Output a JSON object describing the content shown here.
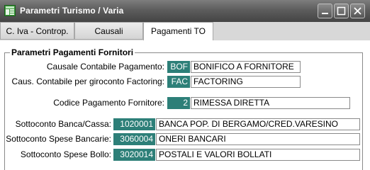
{
  "window": {
    "title": "Parametri Turismo / Varia",
    "minimize_label": "_",
    "maximize_label": "□",
    "close_label": "✕"
  },
  "tabs": [
    {
      "label": "C. Iva - Controp.",
      "active": false
    },
    {
      "label": "Causali",
      "active": false
    },
    {
      "label": "Pagamenti TO",
      "active": true
    }
  ],
  "group": {
    "title": "Parametri Pagamenti Fornitori"
  },
  "fields": {
    "causale_pagamento": {
      "label": "Causale Contabile Pagamento:",
      "code": "BOF",
      "value": "BONIFICO A FORNITORE"
    },
    "causale_giroconto": {
      "label": "Caus. Contabile per giroconto Factoring:",
      "code": "FAC",
      "value": "FACTORING"
    },
    "codice_pagamento": {
      "label": "Codice Pagamento Fornitore:",
      "code": "2",
      "value": "RIMESSA DIRETTA"
    },
    "sottoconto_banca": {
      "label": "Sottoconto Banca/Cassa:",
      "code": "1020001",
      "value": "BANCA POP. DI BERGAMO/CRED.VARESINO"
    },
    "sottoconto_spese_bancarie": {
      "label": "Sottoconto Spese Bancarie:",
      "code": "3060004",
      "value": "ONERI BANCARI"
    },
    "sottoconto_spese_bollo": {
      "label": "Sottoconto Spese Bollo:",
      "code": "3020014",
      "value": "POSTALI E VALORI BOLLATI"
    }
  },
  "colors": {
    "code_bg": "#2d7f78",
    "titlebar": "#5d5d5d"
  }
}
